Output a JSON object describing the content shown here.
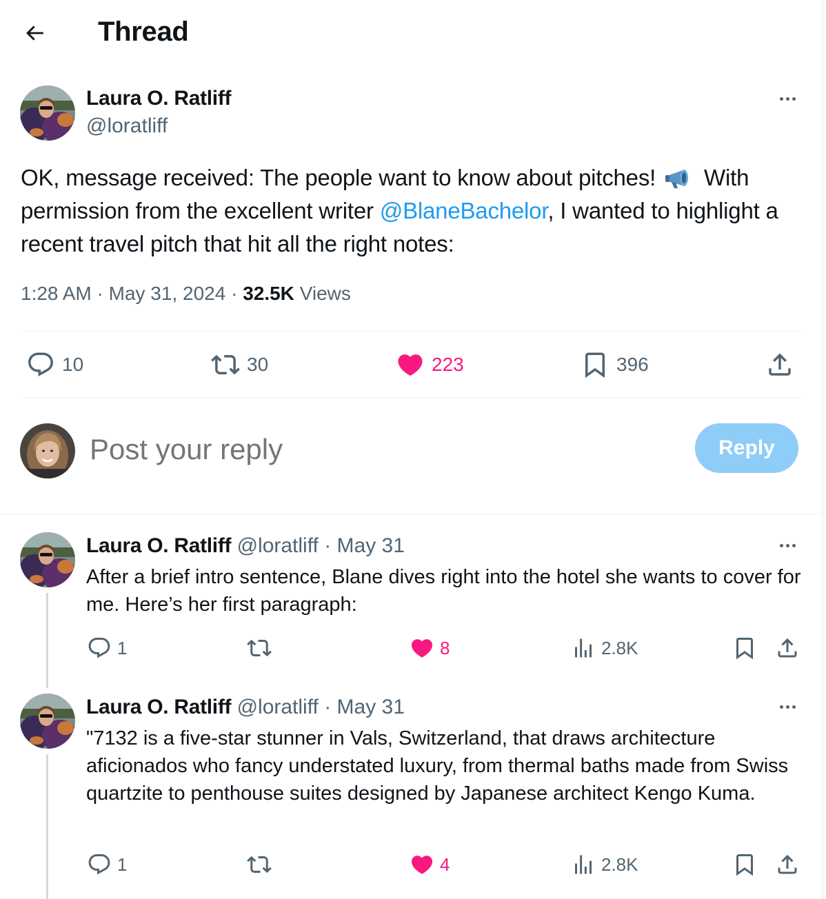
{
  "header": {
    "title": "Thread"
  },
  "main_tweet": {
    "name": "Laura O. Ratliff",
    "handle": "@loratliff",
    "text_part1": "OK, message received: The people want to know about pitches!",
    "text_part2": "With permission from the excellent writer",
    "mention": "@BlaneBachelor",
    "text_part3": ", I wanted to highlight a recent travel pitch that hit all the right notes:",
    "time": "1:28 AM",
    "sep": "·",
    "date": "May 31, 2024",
    "views_count": "32.5K",
    "views_label": "Views",
    "replies": "10",
    "reposts": "30",
    "likes": "223",
    "bookmarks": "396"
  },
  "composer": {
    "placeholder": "Post your reply",
    "button": "Reply"
  },
  "replies": [
    {
      "name": "Laura O. Ratliff",
      "handle": "@loratliff",
      "sep": "·",
      "date": "May 31",
      "text": "After a brief intro sentence, Blane dives right into the hotel she wants to cover for me. Here’s her first paragraph:",
      "replies": "1",
      "likes": "8",
      "views": "2.8K"
    },
    {
      "name": "Laura O. Ratliff",
      "handle": "@loratliff",
      "sep": "·",
      "date": "May 31",
      "text": "\"7132 is a five-star stunner in Vals, Switzerland, that draws architecture aficionados who fancy understated luxury, from thermal baths made from Swiss quartzite to penthouse suites designed by Japanese architect Kengo Kuma.",
      "replies": "1",
      "likes": "4",
      "views": "2.8K"
    }
  ],
  "colors": {
    "accent": "#1d9bf0",
    "like": "#f91880",
    "muted": "#536471",
    "reply_button": "#8ecdf8"
  },
  "icons": [
    "back-arrow-icon",
    "more-icon",
    "megaphone-icon",
    "reply-icon",
    "repost-icon",
    "heart-icon",
    "bookmark-icon",
    "share-icon",
    "views-icon"
  ]
}
